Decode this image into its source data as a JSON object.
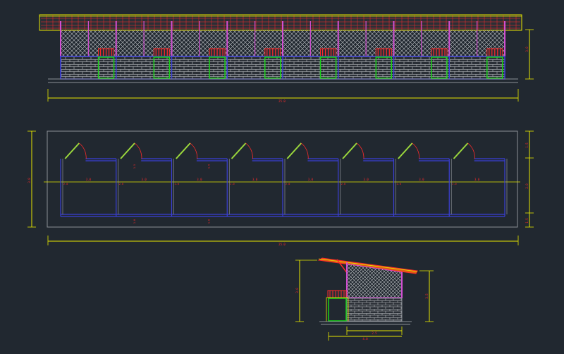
{
  "drawing": {
    "elevation": {
      "overall_dim": "25.0",
      "height_dim": "3.0",
      "bay_count": 8
    },
    "plan": {
      "overall_dim": "25.0",
      "left_dim": "3.8",
      "unit_width": "3.0",
      "wall_label": "2.0",
      "depth_dims": [
        "1.5",
        "1.0"
      ],
      "right_dims": [
        "1.5",
        "2.0",
        "1.5"
      ],
      "unit_count": 8
    },
    "section": {
      "base_dim": "4.0",
      "inner_dim": "2.5",
      "left_height_dim": "3.0",
      "right_height_dim": "3.5"
    },
    "colors": {
      "background": "#212830",
      "dimension": "#e6e600",
      "dim_text": "#ff2a2a",
      "wall_blue": "#3b3fd6",
      "mesh": "#c8c8c8",
      "post_magenta": "#d24fd2",
      "door_green": "#19d219",
      "roof_green": "#9bd83c",
      "accent_red": "#ff2a2a",
      "grey_line": "#8a8f96"
    }
  }
}
